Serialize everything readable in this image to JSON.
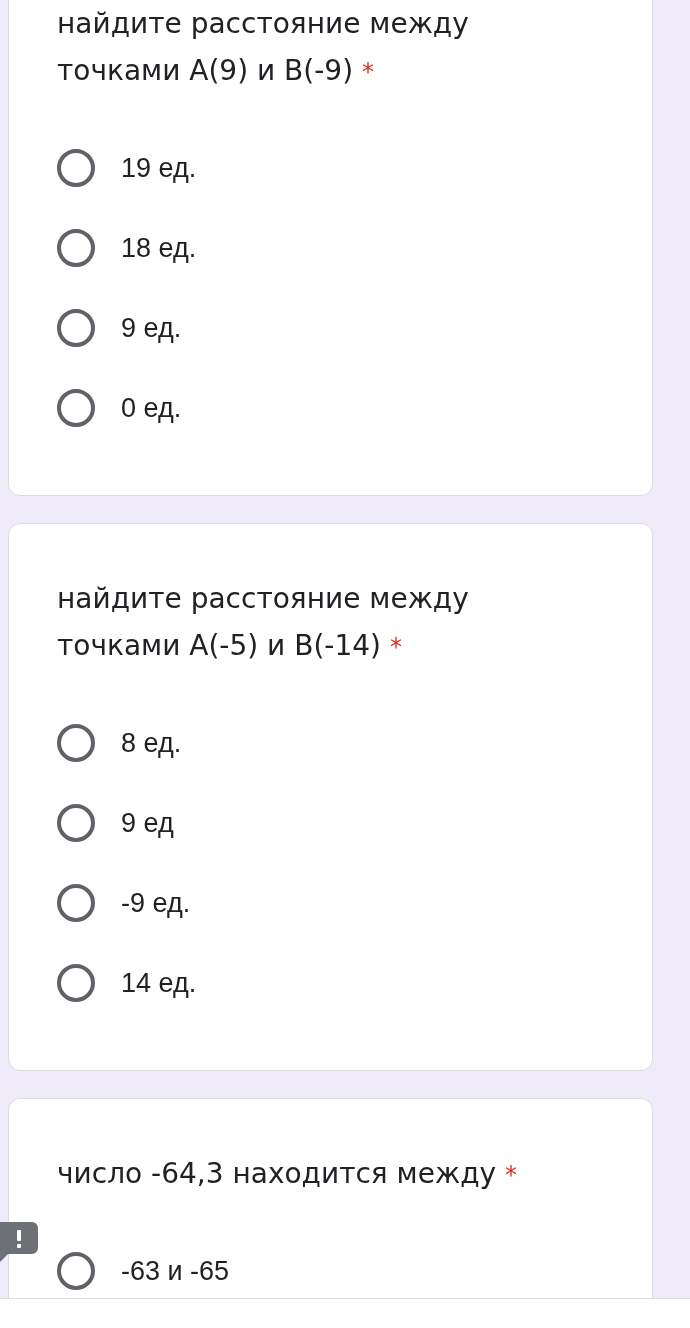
{
  "questions": [
    {
      "text": "найдите расстояние между точками A(9) и B(-9)",
      "required_mark": "*",
      "options": [
        {
          "label": "19 ед.",
          "selected": false
        },
        {
          "label": "18 ед.",
          "selected": false
        },
        {
          "label": "9 ед.",
          "selected": false
        },
        {
          "label": "0 ед.",
          "selected": false
        }
      ]
    },
    {
      "text": "найдите расстояние между точками A(-5) и B(-14)",
      "required_mark": "*",
      "options": [
        {
          "label": "8 ед.",
          "selected": false
        },
        {
          "label": "9 ед",
          "selected": false
        },
        {
          "label": "-9 ед.",
          "selected": false
        },
        {
          "label": "14 ед.",
          "selected": false
        }
      ]
    },
    {
      "text": "число -64,3 находится между",
      "required_mark": "*",
      "options": [
        {
          "label": "-63 и -65",
          "selected": false
        }
      ]
    }
  ]
}
